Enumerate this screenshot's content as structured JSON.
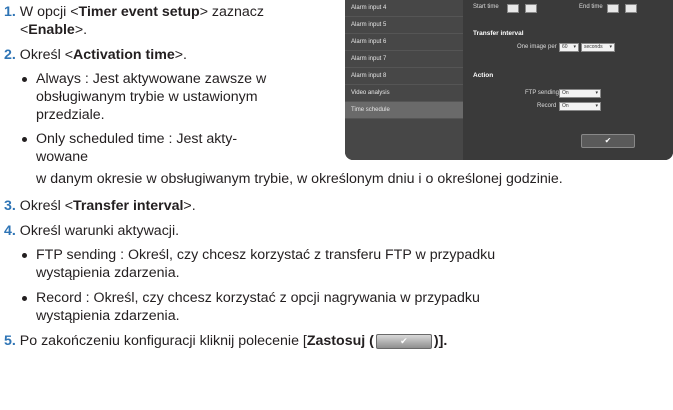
{
  "steps": {
    "s1": {
      "num": "1.",
      "pre": " W opcji <",
      "b1": "Timer event setup",
      "mid": "> zaznacz",
      "l2pre": "<",
      "b2": "Enable",
      "l2post": ">."
    },
    "s2": {
      "num": "2.",
      "pre": " Określ <",
      "b1": "Activation time",
      "post": ">."
    },
    "s2_b1": {
      "l1": "Always : Jest aktywowane zawsze w",
      "l2": "obsługiwanym trybie w ustawionym",
      "l3": "przedziale."
    },
    "s2_b2": {
      "l1": "Only scheduled time : Jest akty-",
      "l2": "wowane",
      "l3": "w danym okresie w obsługiwanym trybie, w określonym dniu i o określonej godzinie."
    },
    "s3": {
      "num": "3.",
      "pre": " Określ <",
      "b1": "Transfer interval",
      "post": ">."
    },
    "s4": {
      "num": "4.",
      "text": " Określ warunki aktywacji."
    },
    "s4_b1": {
      "l1": "FTP sending : Określ, czy chcesz korzystać z transferu FTP w przypadku",
      "l2": "wystąpienia zdarzenia."
    },
    "s4_b2": {
      "l1": "Record : Określ, czy chcesz korzystać z opcji nagrywania w przypadku",
      "l2": "wystąpienia zdarzenia."
    },
    "s5": {
      "num": "5.",
      "pre": " Po zakończeniu konfiguracji kliknij polecenie [",
      "b1": "Zastosuj (",
      "btn": "✔",
      "post": ")]."
    }
  },
  "screenshot": {
    "sidebar": [
      "Alarm input 4",
      "Alarm input 5",
      "Alarm input 6",
      "Alarm input 7",
      "Alarm input 8",
      "Video analysis",
      "Time schedule"
    ],
    "start_time": "Start time",
    "end_time": "End time",
    "transfer_interval": "Transfer interval",
    "one_image_per": "One image per",
    "one_image_value": "60",
    "unit": "seconds",
    "action": "Action",
    "ftp_sending": "FTP sending",
    "ftp_value": "On",
    "record": "Record",
    "record_value": "On",
    "ok": "✔"
  }
}
